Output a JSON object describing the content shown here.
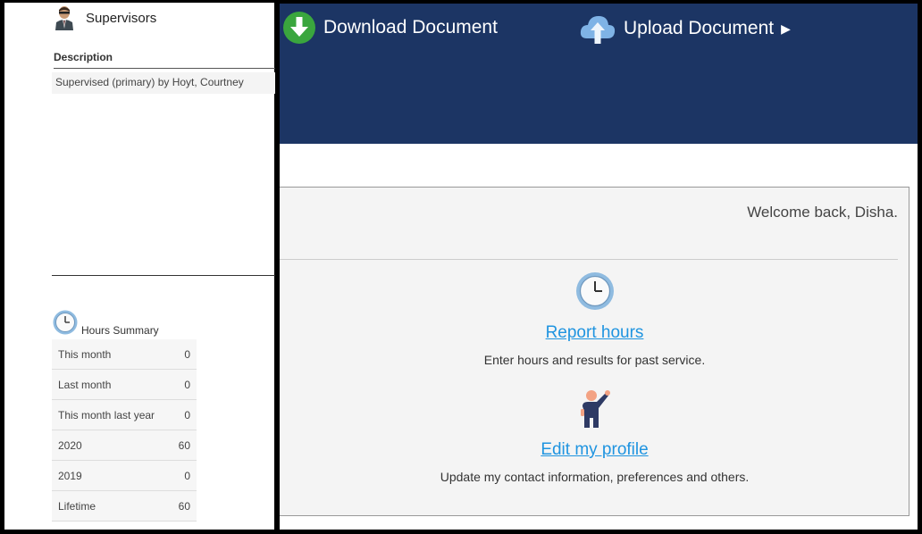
{
  "supervisors": {
    "title": "Supervisors",
    "description_header": "Description",
    "rows": [
      "Supervised (primary) by Hoyt, Courtney"
    ]
  },
  "hours_summary": {
    "title": "Hours Summary",
    "rows": [
      {
        "label": "This month",
        "value": "0"
      },
      {
        "label": "Last month",
        "value": "0"
      },
      {
        "label": "This month last year",
        "value": "0"
      },
      {
        "label": "2020",
        "value": "60"
      },
      {
        "label": "2019",
        "value": "0"
      },
      {
        "label": "Lifetime",
        "value": "60"
      }
    ]
  },
  "toolbar": {
    "download_label": "Download Document",
    "upload_label": "Upload Document",
    "upload_caret": "▶"
  },
  "main": {
    "welcome": "Welcome back, Disha.",
    "actions": [
      {
        "link": "Report hours",
        "desc": "Enter hours and results for past service.",
        "icon": "clock-icon"
      },
      {
        "link": "Edit my profile",
        "desc": "Update my contact information, preferences and others.",
        "icon": "volunteer-icon"
      }
    ]
  },
  "colors": {
    "banner": "#1c3564",
    "link": "#1f94e0",
    "download_icon": "#3aa63e",
    "upload_icon": "#7fb3e6"
  }
}
